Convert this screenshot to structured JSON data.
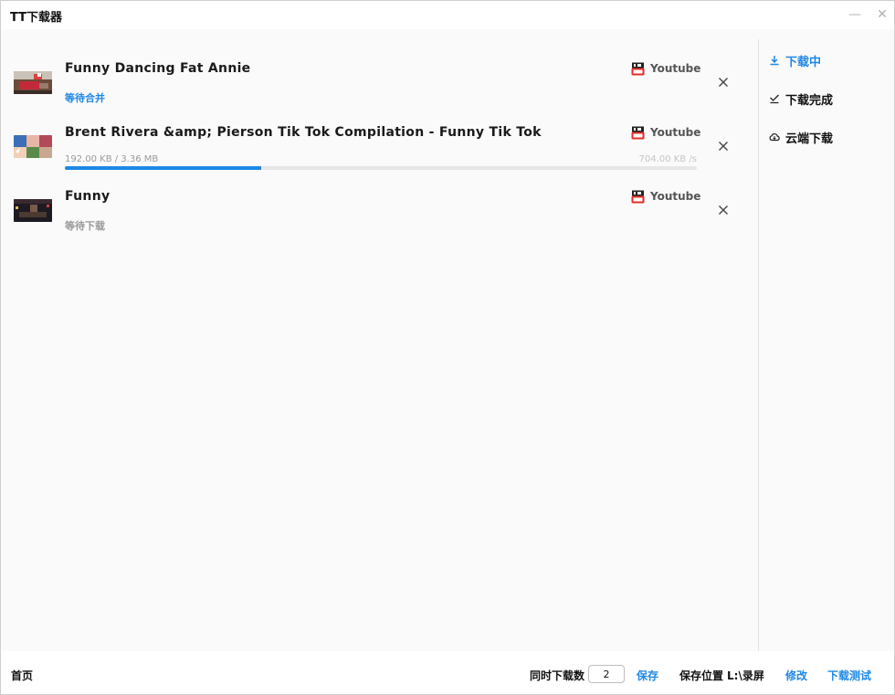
{
  "window": {
    "title": "TT下载器",
    "minimize_glyph": "—",
    "close_glyph": "✕"
  },
  "sidebar": {
    "items": [
      {
        "label": "下载中",
        "icon": "download-icon",
        "active": true
      },
      {
        "label": "下载完成",
        "icon": "check-icon",
        "active": false
      },
      {
        "label": "云端下载",
        "icon": "cloud-download-icon",
        "active": false
      }
    ]
  },
  "downloads": [
    {
      "title": "Funny Dancing Fat Annie",
      "source": "Youtube",
      "status": "等待合并",
      "status_color": "#1e88e5"
    },
    {
      "title": "Brent Rivera &amp; Pierson Tik Tok Compilation - Funny Tik Tok",
      "source": "Youtube",
      "progress_text": "192.00 KB / 3.36 MB",
      "speed": "704.00 KB /s",
      "progress": 0.31
    },
    {
      "title": "Funny",
      "source": "Youtube",
      "status": "等待下载",
      "status_color": "#9a9a9a"
    }
  ],
  "footer": {
    "home_label": "首页",
    "concurrency_label": "同时下载数",
    "concurrency_value": "2",
    "save_label": "保存",
    "save_location_label": "保存位置",
    "save_location_value": "L:\\录屏",
    "modify_label": "修改",
    "test_label": "下载测试"
  },
  "colors": {
    "accent": "#1e88e5",
    "youtube_red": "#e52d27"
  }
}
